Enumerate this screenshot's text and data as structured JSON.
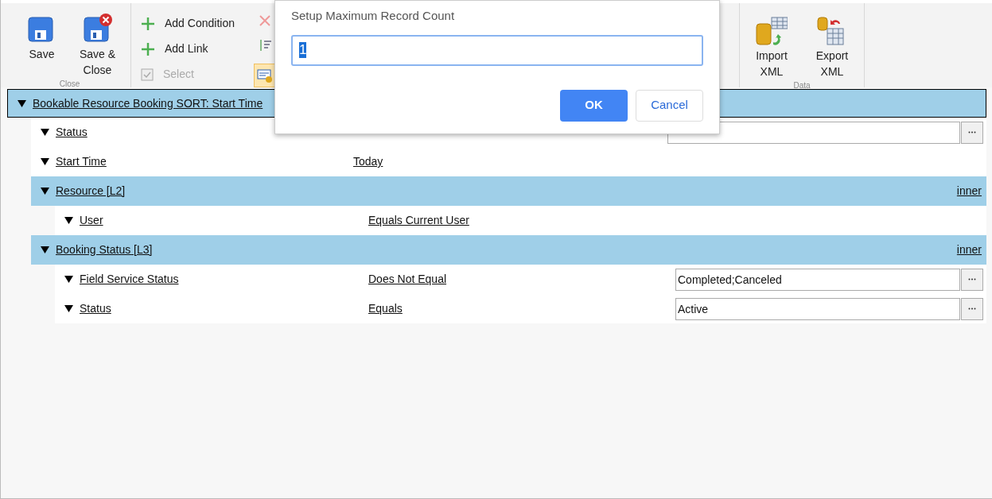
{
  "ribbon": {
    "groups": [
      {
        "kind": "close",
        "label": "Close",
        "items": [
          {
            "label": "Save",
            "disabled": false
          },
          {
            "label": "Save & Close",
            "disabled": false
          }
        ]
      },
      {
        "kind": "edit",
        "items": [
          {
            "label": "Add Condition",
            "disabled": false
          },
          {
            "label": "Add Link",
            "disabled": false
          },
          {
            "label": "Select",
            "disabled": true
          }
        ]
      },
      {
        "kind": "data",
        "label": "Data",
        "items": [
          {
            "label": "Import XML",
            "disabled": false
          },
          {
            "label": "Export XML",
            "disabled": false
          }
        ]
      }
    ]
  },
  "tree": {
    "label": "Bookable Resource Booking SORT: Start Time",
    "expanded": true,
    "children": [
      {
        "kind": "condition",
        "field": "Status",
        "value_field": true,
        "expanded": true
      },
      {
        "kind": "condition",
        "field": "Start Time",
        "operator": "Today",
        "expanded": true
      },
      {
        "kind": "link",
        "label": "Resource [L2]",
        "join": "inner",
        "expanded": true,
        "children": [
          {
            "kind": "condition",
            "field": "User",
            "operator": "Equals Current User",
            "expanded": true
          }
        ]
      },
      {
        "kind": "link",
        "label": "Booking Status [L3]",
        "join": "inner",
        "expanded": true,
        "children": [
          {
            "kind": "condition",
            "field": "Field Service Status",
            "operator": "Does Not Equal",
            "value_field": true,
            "value": "Completed;Canceled",
            "expanded": true
          },
          {
            "kind": "condition",
            "field": "Status",
            "operator": "Equals",
            "value_field": true,
            "value": "Active",
            "expanded": true
          }
        ]
      }
    ]
  },
  "dialog": {
    "title": "Setup Maximum Record Count",
    "value": "1",
    "buttons": [
      {
        "label": "OK",
        "kind": "primary"
      },
      {
        "label": "Cancel",
        "kind": "secondary"
      }
    ]
  }
}
